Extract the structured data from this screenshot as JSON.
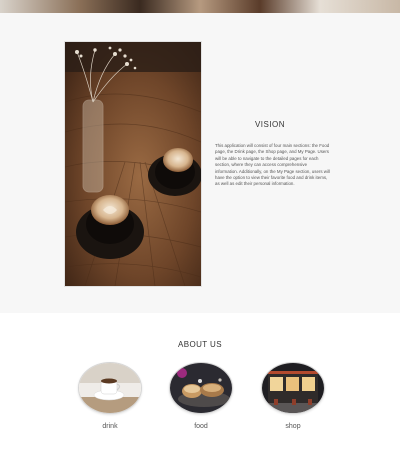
{
  "vision": {
    "title": "VISION",
    "body": "This application will consist of four main sections: the Food page, the Drink page, the Shop page, and My Page. Users will be able to navigate to the detailed pages for each section, where they can access comprehensive information. Additionally, on the My Page section, users will have the option to view their favorite food and drink items, as well as edit their personal information.",
    "image_icon": "coffee-table-photo"
  },
  "about": {
    "title": "ABOUT US",
    "items": [
      {
        "label": "drink",
        "icon": "coffee-cup-photo"
      },
      {
        "label": "food",
        "icon": "pastry-photo"
      },
      {
        "label": "shop",
        "icon": "storefront-photo"
      }
    ]
  },
  "colors": {
    "section_background": "#f7f7f7",
    "page_background": "#ffffff",
    "text": "#333333"
  }
}
